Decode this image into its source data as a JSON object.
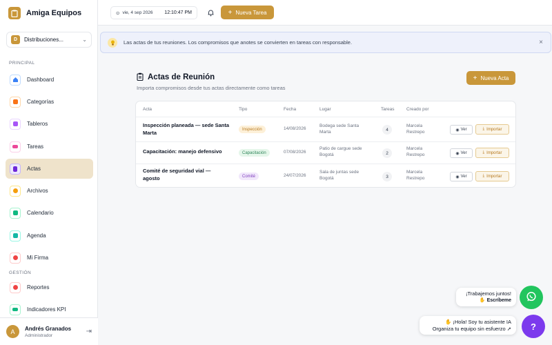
{
  "app": {
    "title": "Amiga Equipos"
  },
  "workspace": {
    "badge": "D",
    "name": "Distribuciones..."
  },
  "sidebar": {
    "section_principal": "PRINCIPAL",
    "section_gestion": "GESTIÓN",
    "items": [
      {
        "label": "Dashboard",
        "icon": "home-icon",
        "color": "#3b82f6"
      },
      {
        "label": "Categorías",
        "icon": "categories-icon",
        "color": "#f97316"
      },
      {
        "label": "Tableros",
        "icon": "boards-icon",
        "color": "#a855f7"
      },
      {
        "label": "Tareas",
        "icon": "tasks-icon",
        "color": "#ec4899"
      },
      {
        "label": "Actas",
        "icon": "document-icon",
        "color": "#6d28d9"
      },
      {
        "label": "Archivos",
        "icon": "files-icon",
        "color": "#f59e0b"
      },
      {
        "label": "Calendario",
        "icon": "calendar-icon",
        "color": "#10b981"
      },
      {
        "label": "Agenda",
        "icon": "agenda-icon",
        "color": "#14b8a6"
      },
      {
        "label": "Mi Firma",
        "icon": "signature-icon",
        "color": "#ef4444"
      },
      {
        "label": "Reportes",
        "icon": "reports-icon",
        "color": "#ef4444"
      },
      {
        "label": "Indicadores KPI",
        "icon": "kpi-icon",
        "color": "#10b981"
      }
    ]
  },
  "user": {
    "initial": "A",
    "name": "Andrés Granados",
    "role": "Administrador"
  },
  "topbar": {
    "date": "vie, 4 sep 2026",
    "time": "12:10:47 PM",
    "new_task": "Nueva Tarea"
  },
  "banner": {
    "text": "Las actas de tus reuniones. Los compromisos que anotes se convierten en tareas con responsable."
  },
  "content": {
    "title": "Actas de Reunión",
    "subtitle": "Importa compromisos desde tus actas directamente como tareas",
    "new_button": "Nueva Acta"
  },
  "table": {
    "headers": {
      "acta": "Acta",
      "tipo": "Tipo",
      "fecha": "Fecha",
      "lugar": "Lugar",
      "tareas": "Tareas",
      "creado": "Creado por"
    },
    "rows": [
      {
        "name": "Inspección planeada — sede Santa Marta",
        "tipo": "Inspección",
        "fecha": "14/08/2026",
        "lugar": "Bodega sede Santa Marta",
        "tareas": "4",
        "creado": "Marcela Restrepo"
      },
      {
        "name": "Capacitación: manejo defensivo",
        "tipo": "Capacitación",
        "fecha": "07/08/2026",
        "lugar": "Patio de cargue sede Bogotá",
        "tareas": "2",
        "creado": "Marcela Restrepo"
      },
      {
        "name": "Comité de seguridad vial — agosto",
        "tipo": "Comité",
        "fecha": "24/07/2026",
        "lugar": "Sala de juntas sede Bogotá",
        "tareas": "3",
        "creado": "Marcela Restrepo"
      }
    ],
    "btn_view": "Ver",
    "btn_import": "Importar"
  },
  "floating": {
    "whatsapp_line1": "¡Trabajemos juntos!",
    "whatsapp_line2": "Escríbeme",
    "ai_line1": "¡Hola! Soy tu asistente IA",
    "ai_line2": "Organiza tu equipo sin esfuerzo",
    "help_label": "?"
  }
}
